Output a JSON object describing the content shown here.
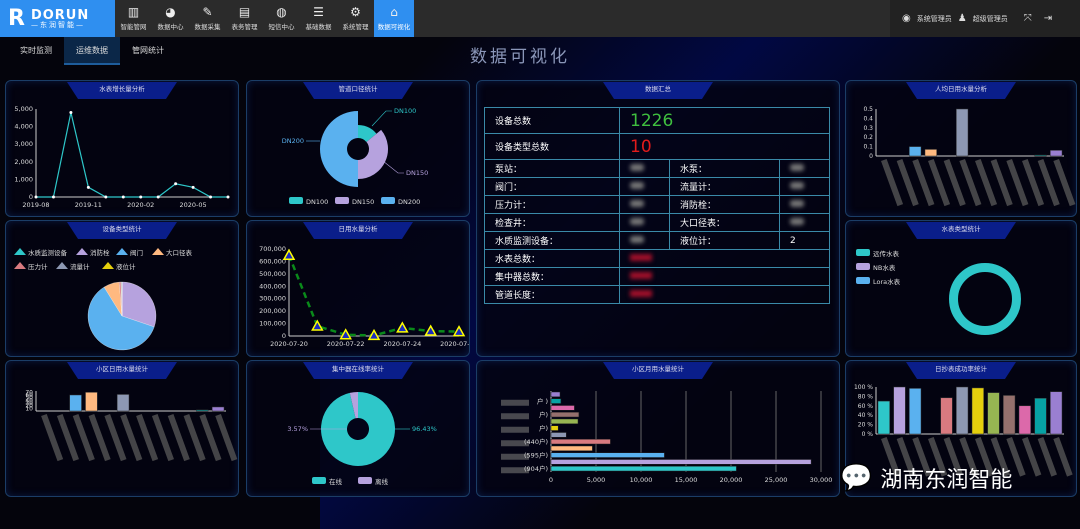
{
  "nav": {
    "logo_en": "DORUN",
    "logo_cn": "—东润智能—",
    "items": [
      {
        "label": "智能管网",
        "icon": "map-icon"
      },
      {
        "label": "数据中心",
        "icon": "pie-chart-icon"
      },
      {
        "label": "数据采集",
        "icon": "pencil-icon"
      },
      {
        "label": "表务管理",
        "icon": "document-icon"
      },
      {
        "label": "短信中心",
        "icon": "chat-icon"
      },
      {
        "label": "基础数据",
        "icon": "database-icon"
      },
      {
        "label": "系统管理",
        "icon": "gears-icon"
      },
      {
        "label": "数据可视化",
        "icon": "home-icon",
        "active": true
      }
    ],
    "user_role": "系统管理员",
    "user_name": "超级管理员"
  },
  "subtabs": [
    {
      "label": "实时监测"
    },
    {
      "label": "运维数据",
      "active": true
    },
    {
      "label": "管网统计"
    }
  ],
  "page_title": "数据可视化",
  "summary": {
    "title": "数据汇总",
    "total_label": "设备总数",
    "total": "1226",
    "types_label": "设备类型总数",
    "types": "10",
    "rows": [
      [
        "泵站：",
        "水泵："
      ],
      [
        "阀门：",
        "流量计："
      ],
      [
        "压力计：",
        "消防栓："
      ],
      [
        "检查井：",
        "大口径表："
      ],
      [
        "水质监测设备：",
        "液位计："
      ]
    ],
    "level_value": "2",
    "meter_label": "水表总数：",
    "concentrator_label": "集中器总数：",
    "pipe_label": "管道长度：",
    "colors": {
      "total": "#3fbf3f",
      "types": "#e21b1b"
    }
  },
  "watermark": "湖南东润智能",
  "palette": [
    "#2ec7c9",
    "#b6a2de",
    "#5ab1ef",
    "#ffb980",
    "#d87a80",
    "#8d98b3",
    "#e5cf0d",
    "#97b552",
    "#95706d",
    "#dc69aa",
    "#07a2a4",
    "#9a7fd1"
  ],
  "chart_data": [
    {
      "id": "growth",
      "title": "水表增长量分析",
      "type": "line",
      "x": [
        "2019-08",
        "2019-09",
        "2019-10",
        "2019-11",
        "2019-12",
        "2020-01",
        "2020-02",
        "2020-03",
        "2020-04",
        "2020-05",
        "2020-06",
        "2020-07"
      ],
      "values": [
        0,
        0,
        4800,
        550,
        0,
        0,
        0,
        0,
        750,
        550,
        0,
        0
      ],
      "xticks": [
        "2019-08",
        "2019-11",
        "2020-02",
        "2020-05"
      ],
      "yticks": [
        "0",
        "1,000",
        "2,000",
        "3,000",
        "4,000",
        "5,000"
      ],
      "ylim": [
        0,
        5000
      ],
      "color": "#2ec7c9"
    },
    {
      "id": "pipe",
      "title": "管道口径统计",
      "type": "pie",
      "rose": true,
      "categories": [
        "DN100",
        "DN150",
        "DN200"
      ],
      "values": [
        14,
        36,
        50
      ],
      "legend": "bottom"
    },
    {
      "id": "devtype",
      "title": "设备类型统计",
      "type": "pie",
      "categories": [
        "水质监测设备",
        "消防栓",
        "阀门",
        "大口径表",
        "压力计",
        "流量计",
        "液位计"
      ],
      "values": [
        0.2,
        30,
        61,
        7.5,
        0.8,
        0.4,
        0.1
      ],
      "legend": "top"
    },
    {
      "id": "daily",
      "title": "日用水量分析",
      "type": "line",
      "x": [
        "2020-07-20",
        "2020-07-21",
        "2020-07-22",
        "2020-07-23",
        "2020-07-24",
        "2020-07-25",
        "2020-07-26"
      ],
      "values": [
        650000,
        80000,
        10000,
        5000,
        65000,
        40000,
        35000
      ],
      "xticks": [
        "2020-07-20",
        "2020-07-22",
        "2020-07-24",
        "2020-07-26"
      ],
      "yticks": [
        "0",
        "100,000",
        "200,000",
        "300,000",
        "400,000",
        "500,000",
        "600,000",
        "700,000"
      ],
      "ylim": [
        0,
        700000
      ],
      "color": "#0a8a1a",
      "dashed": true
    },
    {
      "id": "percap",
      "title": "人均日用水量分析",
      "type": "bar",
      "values": [
        0,
        0,
        0.1,
        0.07,
        0,
        0.5,
        0,
        0,
        0,
        0,
        0.01,
        0.06
      ],
      "yticks": [
        "0",
        "0.1",
        "0.2",
        "0.3",
        "0.4",
        "0.5"
      ],
      "ylim": [
        0,
        0.5
      ]
    },
    {
      "id": "meter",
      "title": "水表类型统计",
      "type": "donut",
      "categories": [
        "远传水表",
        "NB水表",
        "Lora水表"
      ],
      "values": [
        100,
        0,
        0
      ],
      "legend": "top-left"
    },
    {
      "id": "district_daily",
      "title": "小区日用水量统计",
      "type": "bar",
      "values": [
        0,
        0,
        60,
        70,
        0,
        62,
        0,
        0,
        0,
        0,
        4,
        15
      ],
      "yticks": [
        "10",
        "20",
        "30",
        "40",
        "50",
        "60",
        "70"
      ],
      "ylim": [
        0,
        75
      ]
    },
    {
      "id": "online",
      "title": "集中器在线率统计",
      "type": "pie",
      "categories": [
        "在线",
        "离线"
      ],
      "values": [
        96.43,
        3.57
      ],
      "labels": [
        "96.43%",
        "3.57%"
      ],
      "legend": "bottom"
    },
    {
      "id": "district_month",
      "title": "小区月用水量统计",
      "type": "hbar",
      "values": [
        20600,
        28900,
        12600,
        4600,
        6600,
        1700,
        800,
        3000,
        3100,
        2600,
        1100,
        1000
      ],
      "ylabels": [
        "(904户)",
        "",
        "(595户)",
        "",
        "(440户)",
        "",
        "户)",
        "",
        "户)",
        "",
        "户 )",
        ""
      ],
      "xticks": [
        "0",
        "5,000",
        "10,000",
        "15,000",
        "20,000",
        "25,000",
        "30,000"
      ],
      "xlim": [
        0,
        30000
      ]
    },
    {
      "id": "success",
      "title": "日抄表成功率统计",
      "type": "bar",
      "values": [
        70,
        100,
        97,
        0,
        77,
        100,
        98,
        88,
        82,
        60,
        76,
        90
      ],
      "yticks": [
        "0 %",
        "20 %",
        "40 %",
        "60 %",
        "80 %",
        "100 %"
      ],
      "ylim": [
        0,
        100
      ]
    }
  ]
}
